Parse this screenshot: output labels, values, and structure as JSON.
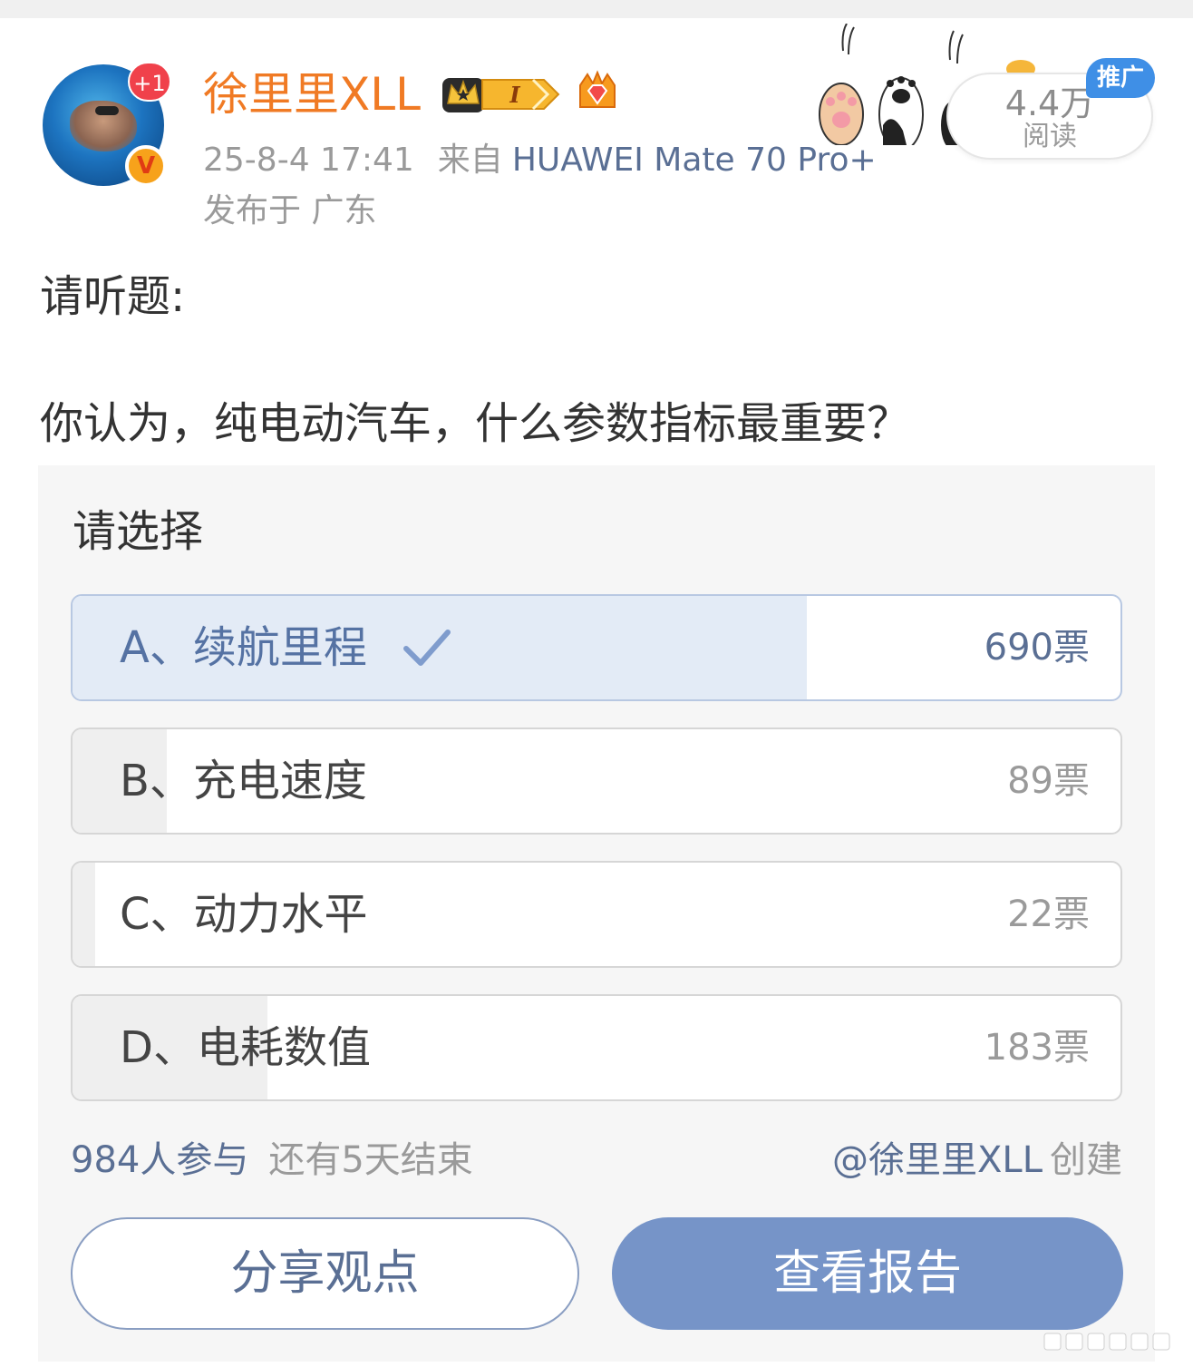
{
  "header": {
    "plus_badge": "+1",
    "username": "徐里里XLL",
    "timestamp": "25-8-4 17:41",
    "from_label": "来自",
    "device": "HUAWEI Mate 70 Pro+",
    "location": "发布于 广东",
    "read_count": "4.4万",
    "read_label": "阅读",
    "promo_tag": "推广",
    "badges": [
      "crown-icon",
      "level-badge-icon",
      "vip-diamond-icon"
    ],
    "accent_color": "#f07a24"
  },
  "post": {
    "line1": "请听题:",
    "line2": "你认为，纯电动汽车，什么参数指标最重要？"
  },
  "poll": {
    "title": "请选择",
    "options": [
      {
        "label": "A、续航里程",
        "votes": "690票",
        "fraction": 0.701,
        "selected": true
      },
      {
        "label": "B、充电速度",
        "votes": "89票",
        "fraction": 0.09,
        "selected": false
      },
      {
        "label": "C、动力水平",
        "votes": "22票",
        "fraction": 0.022,
        "selected": false
      },
      {
        "label": "D、电耗数值",
        "votes": "183票",
        "fraction": 0.186,
        "selected": false
      }
    ],
    "participants": "984人参与",
    "remaining": "还有5天结束",
    "creator_handle": "@徐里里XLL",
    "creator_suffix": "创建",
    "share_button": "分享观点",
    "report_button": "查看报告",
    "primary_color": "#7694c8"
  }
}
